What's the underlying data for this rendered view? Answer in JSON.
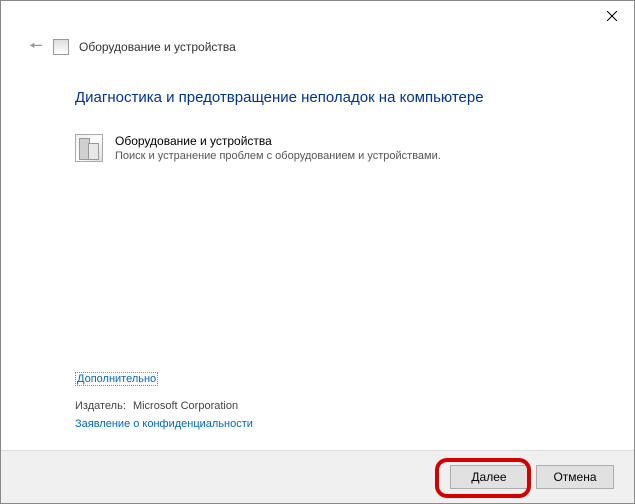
{
  "header": {
    "title": "Оборудование и устройства"
  },
  "main": {
    "heading": "Диагностика и предотвращение неполадок на компьютере",
    "item": {
      "title": "Оборудование и устройства",
      "description": "Поиск и устранение проблем с оборудованием и устройствами."
    }
  },
  "links": {
    "advanced": "Дополнительно",
    "privacy": "Заявление о конфиденциальности"
  },
  "publisher": {
    "label": "Издатель:",
    "value": "Microsoft Corporation"
  },
  "footer": {
    "next": "Далее",
    "cancel": "Отмена"
  }
}
